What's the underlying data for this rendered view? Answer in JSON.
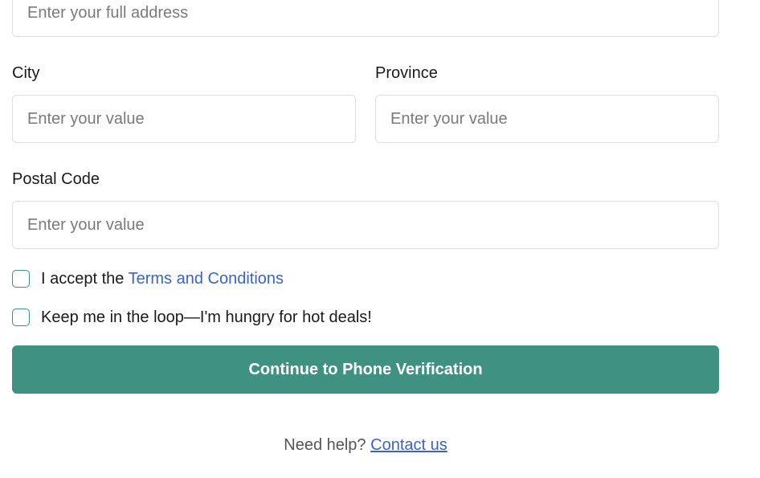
{
  "address": {
    "placeholder": "Enter your full address",
    "value": ""
  },
  "city": {
    "label": "City",
    "placeholder": "Enter your value",
    "value": ""
  },
  "province": {
    "label": "Province",
    "placeholder": "Enter your value",
    "value": ""
  },
  "postal_code": {
    "label": "Postal Code",
    "placeholder": "Enter your value",
    "value": ""
  },
  "terms": {
    "prefix": "I accept the",
    "link_text": "Terms and Conditions",
    "checked": false
  },
  "newsletter": {
    "label": "Keep me in the loop—I'm hungry for hot deals!",
    "checked": false
  },
  "submit": {
    "label": "Continue to Phone Verification"
  },
  "help": {
    "text": "Need help?",
    "link_text": "Contact us"
  },
  "colors": {
    "primary": "#3f9282",
    "link": "#3a63c9",
    "checkbox_border": "#3f8f80",
    "input_border": "#dcdfe3"
  }
}
